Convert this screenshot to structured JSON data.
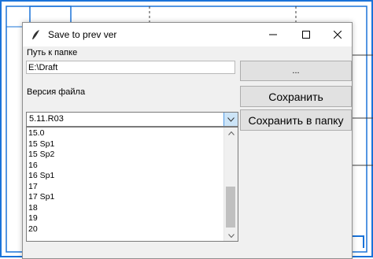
{
  "window": {
    "title": "Save to prev ver",
    "minimize_icon": "minimize-icon",
    "maximize_icon": "maximize-icon",
    "close_icon": "close-icon"
  },
  "folder": {
    "label": "Путь к папке",
    "value": "E:\\Draft",
    "browse_label": "..."
  },
  "version": {
    "label": "Версия файла",
    "selected": "5.11.R03",
    "options": [
      "15.0",
      "15 Sp1",
      "15 Sp2",
      "16",
      "16 Sp1",
      "17",
      "17 Sp1",
      "18",
      "19",
      "20"
    ]
  },
  "actions": {
    "save_label": "Сохранить",
    "save_to_folder_label": "Сохранить в папку"
  },
  "colors": {
    "cad_lines": "#1a73d9",
    "combo_button": "#cce4f7",
    "button_face": "#e1e1e1"
  }
}
